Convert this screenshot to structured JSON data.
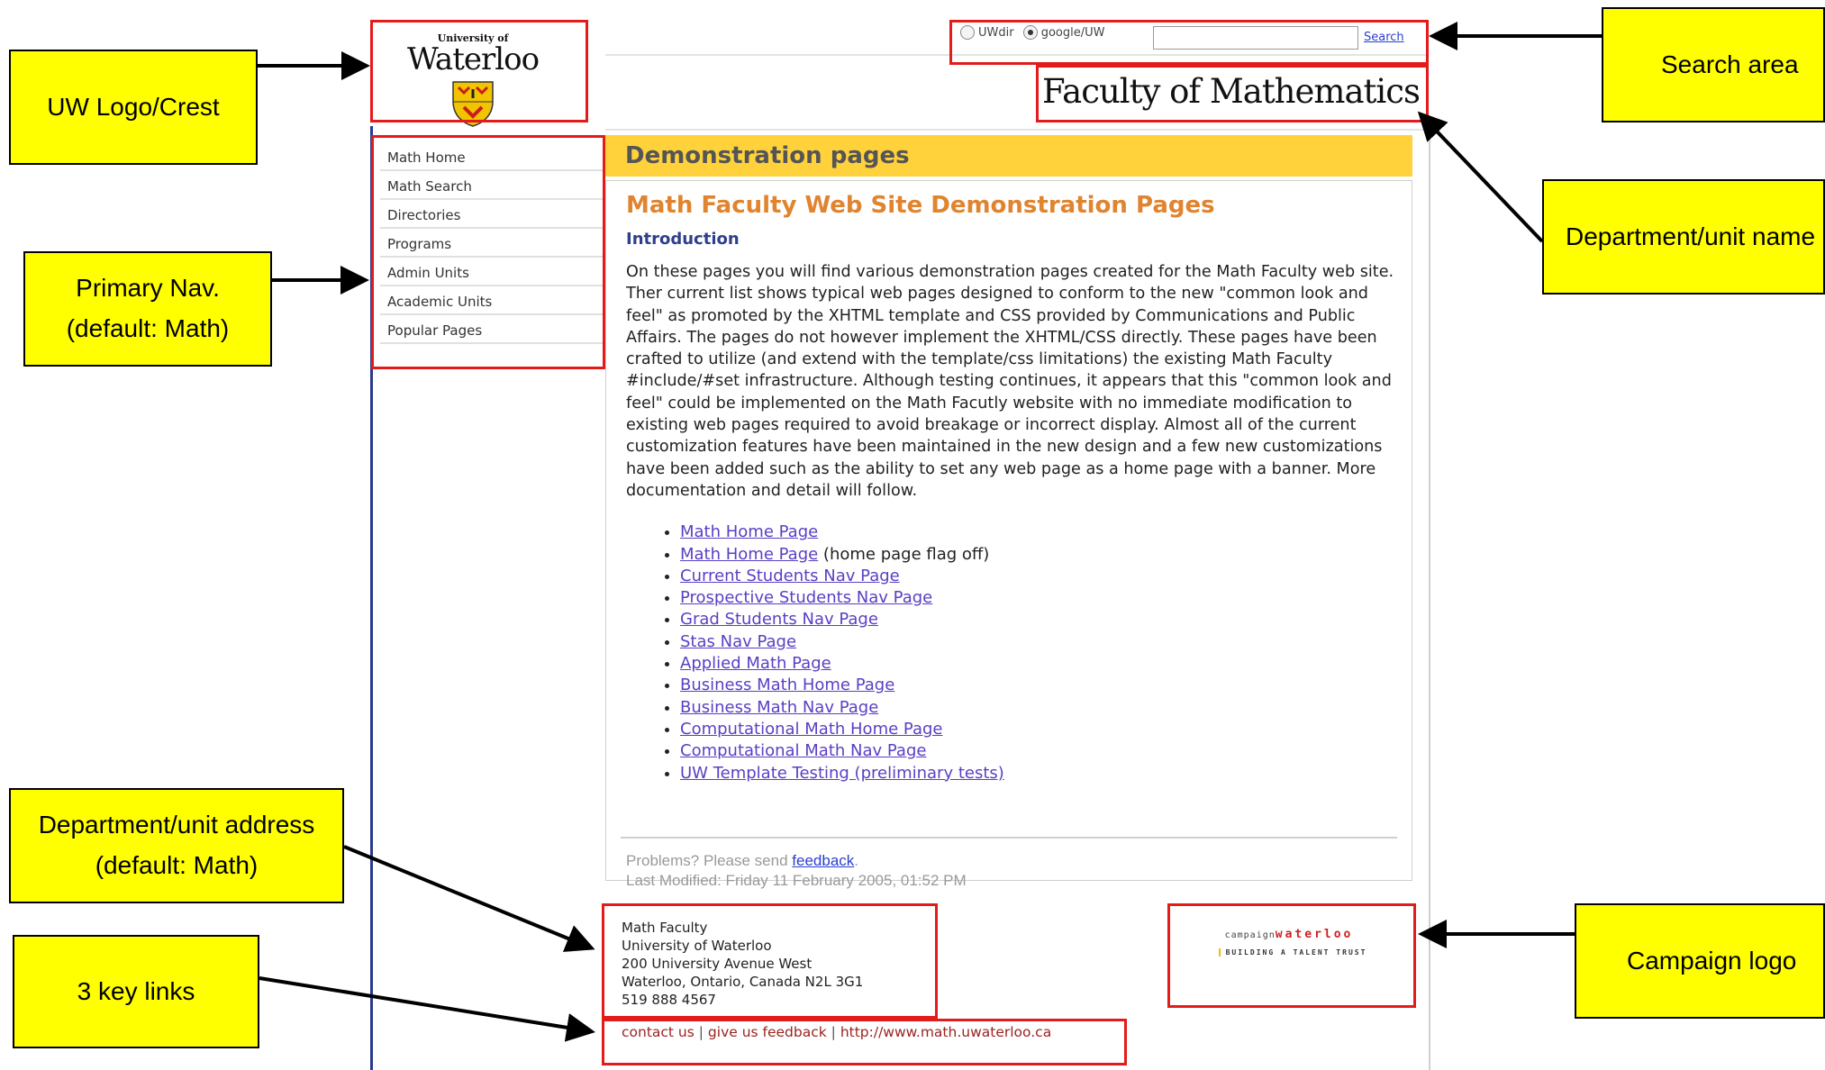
{
  "logo": {
    "small": "University of",
    "big": "Waterloo"
  },
  "search": {
    "option1": "UWdir",
    "option2": "google/UW",
    "selected": "google/UW",
    "input_value": "",
    "button": "Search"
  },
  "faculty_name": "Faculty of Mathematics",
  "nav": [
    "Math Home",
    "Math Search",
    "Directories",
    "Programs",
    "Admin Units",
    "Academic Units",
    "Popular Pages"
  ],
  "banner": "Demonstration pages",
  "content": {
    "title": "Math Faculty Web Site Demonstration Pages",
    "heading": "Introduction",
    "paragraph": "On these pages you will find various demonstration pages created for the Math Faculty web site. Ther current list shows typical web pages designed to conform to the new \"common look and feel\" as promoted by the XHTML template and CSS provided by Communications and Public Affairs. The pages do not however implement the XHTML/CSS directly. These pages have been crafted to utilize (and extend with the template/css limitations) the existing Math Faculty #include/#set infrastructure. Although testing continues, it appears that this \"common look and feel\" could be implemented on the Math Facutly website with no immediate modification to existing web pages required to avoid breakage or incorrect display. Almost all of the current customization features have been maintained in the new design and a few new customizations have been added such as the ability to set any web page as a home page with a banner. More documentation and detail will follow.",
    "links": [
      {
        "text": "Math Home Page",
        "suffix": ""
      },
      {
        "text": "Math Home Page",
        "suffix": " (home page flag off)"
      },
      {
        "text": "Current Students Nav Page",
        "suffix": ""
      },
      {
        "text": "Prospective Students Nav Page",
        "suffix": ""
      },
      {
        "text": "Grad Students Nav Page",
        "suffix": ""
      },
      {
        "text": "Stas Nav Page",
        "suffix": ""
      },
      {
        "text": "Applied Math Page",
        "suffix": ""
      },
      {
        "text": "Business Math Home Page",
        "suffix": ""
      },
      {
        "text": "Business Math Nav Page",
        "suffix": ""
      },
      {
        "text": "Computational Math Home Page",
        "suffix": ""
      },
      {
        "text": "Computational Math Nav Page",
        "suffix": ""
      },
      {
        "text": "UW Template Testing (preliminary tests)",
        "suffix": ""
      }
    ],
    "problems_prefix": "Problems? Please send ",
    "feedback_link": "feedback",
    "problems_suffix": ".",
    "last_modified": "Last Modified:  Friday 11 February 2005, 01:52 PM"
  },
  "address": [
    "Math Faculty",
    "University of Waterloo",
    "200 University Avenue West",
    "Waterloo, Ontario, Canada N2L 3G1",
    "519 888 4567"
  ],
  "key_links": [
    "contact us",
    "give us feedback",
    "http://www.math.uwaterloo.ca"
  ],
  "key_links_sep": " | ",
  "campaign": {
    "prefix": "campaign",
    "name": "waterloo",
    "tagline": "BUILDING A TALENT TRUST"
  },
  "annotations": {
    "logo": "UW Logo/Crest",
    "search": "Search area",
    "dept_name": "Department/unit name",
    "nav_line1": "Primary Nav.",
    "nav_line2": "(default: Math)",
    "address_line1": "Department/unit address",
    "address_line2": "(default: Math)",
    "key_links": "3 key  links",
    "campaign": "Campaign logo"
  },
  "colors": {
    "highlight": "#e31b1b",
    "note_bg": "#ffff00",
    "banner": "#ffd23c",
    "title": "#e0842f"
  }
}
